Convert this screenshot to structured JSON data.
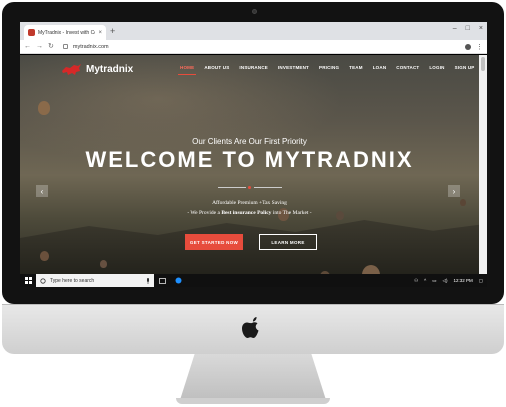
{
  "browser": {
    "tab_title": "MyTradnix - Invest with Confide",
    "tab_close": "×",
    "new_tab": "+",
    "url": "mytradnix.com",
    "window_controls": {
      "minimize": "–",
      "maximize": "□",
      "close": "×"
    }
  },
  "site": {
    "brand": "Mytradnix",
    "nav": [
      {
        "label": "HOME",
        "active": true
      },
      {
        "label": "ABOUT US"
      },
      {
        "label": "INSURANCE"
      },
      {
        "label": "INVESTMENT"
      },
      {
        "label": "PRICING"
      },
      {
        "label": "TEAM"
      },
      {
        "label": "LOAN"
      },
      {
        "label": "CONTACT"
      },
      {
        "label": "LOGIN"
      },
      {
        "label": "SIGN UP"
      }
    ],
    "hero": {
      "tagline": "Our Clients Are Our First Priority",
      "headline": "WELCOME TO MYTRADNIX",
      "sub1": "Affordable Premium +Tax Saving",
      "sub2_pre": "- We Provide a ",
      "sub2_bold": "Best insurance Policy",
      "sub2_post": " into The Market -",
      "cta_primary": "GET STARTED NOW",
      "cta_secondary": "LEARN MORE",
      "prev": "‹",
      "next": "›"
    },
    "accent": "#e74c3c"
  },
  "taskbar": {
    "search_placeholder": "Type here to search",
    "time": "12:32 PM"
  }
}
